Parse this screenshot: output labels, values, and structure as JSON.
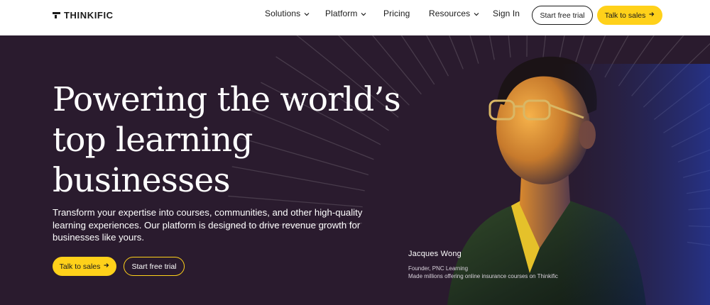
{
  "brand": {
    "name": "THINKIFIC"
  },
  "nav": {
    "items": [
      {
        "label": "Solutions",
        "has_dropdown": true
      },
      {
        "label": "Platform",
        "has_dropdown": true
      },
      {
        "label": "Pricing",
        "has_dropdown": false
      },
      {
        "label": "Resources",
        "has_dropdown": true
      },
      {
        "label": "Sign In",
        "has_dropdown": false
      }
    ],
    "start_trial_label": "Start free trial",
    "talk_sales_label": "Talk to sales"
  },
  "hero": {
    "headline": "Powering the world’s top learning businesses",
    "subheadline": "Transform your expertise into courses, communities, and other high-quality learning experiences. Our platform is designed to drive revenue growth for businesses like yours.",
    "primary_cta": "Talk to sales",
    "secondary_cta": "Start free trial"
  },
  "testimonial": {
    "name": "Jacques Wong",
    "role": "Founder, PNC Learning",
    "quote": "Made millions offering online insurance courses on Thinkific"
  },
  "colors": {
    "hero_bg": "#2a1b2e",
    "accent_yellow": "#ffd11a",
    "text_dark": "#1b1b1b"
  },
  "icons": {
    "dropdown": "chevron-down-icon",
    "cta_arrow": "arrow-right-icon",
    "logo": "thinkific-logo-icon"
  }
}
